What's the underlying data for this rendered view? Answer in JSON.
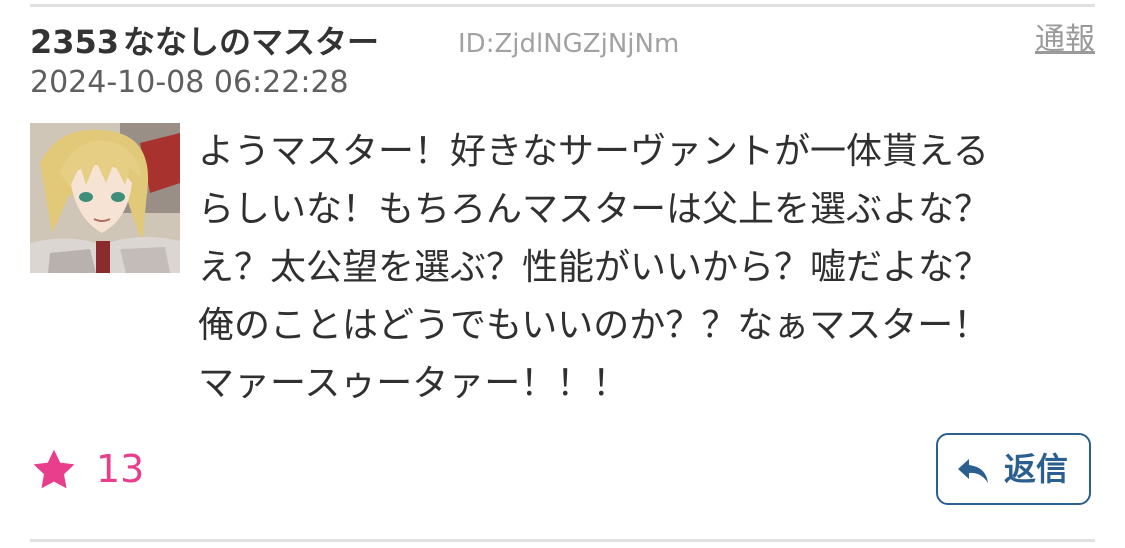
{
  "post": {
    "number": "2353",
    "author": "ななしのマスター",
    "user_id": "ID:ZjdlNGZjNjNm",
    "report_label": "通報",
    "timestamp": "2024-10-08 06:22:28",
    "avatar_icon": "character-avatar",
    "message_lines": [
      "ようマスター！好きなサーヴァントが一体貰える",
      "らしいな！もちろんマスターは父上を選ぶよな？",
      "え？太公望を選ぶ？性能がいいから？嘘だよな？",
      "俺のことはどうでもいいのか？？なぁマスター！",
      "マァースゥータァー！！！"
    ],
    "likes": {
      "icon": "star-icon",
      "count": "13",
      "color": "#e83e8c"
    },
    "reply": {
      "icon": "reply-arrow-icon",
      "label": "返信",
      "color": "#2b5f8f"
    }
  }
}
